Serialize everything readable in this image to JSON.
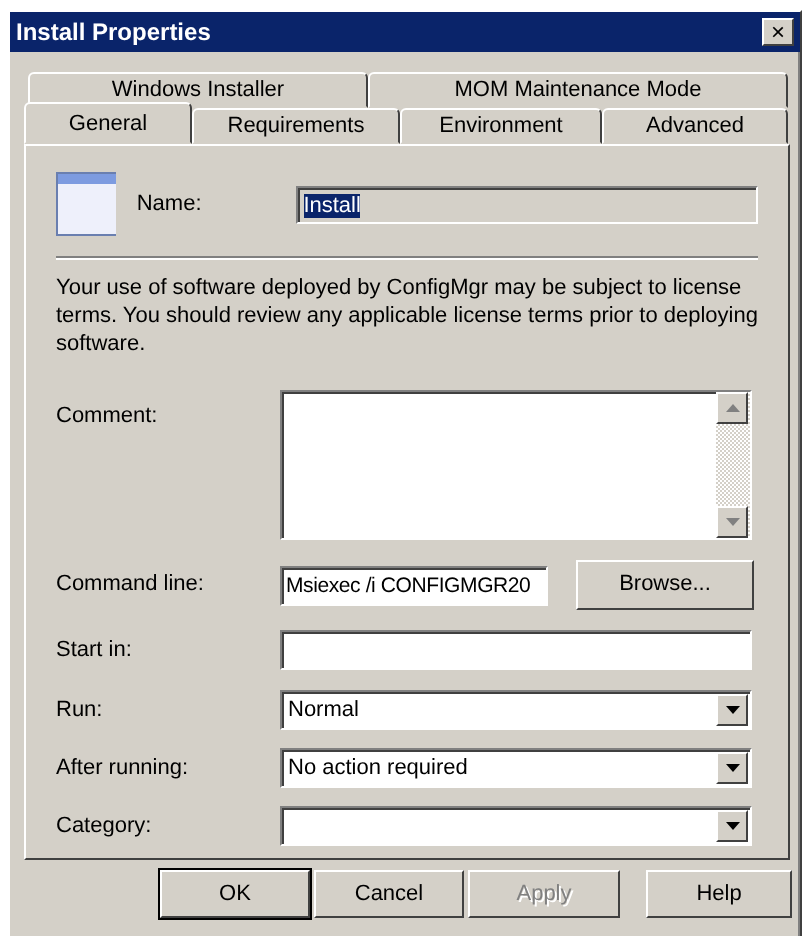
{
  "window": {
    "title": "Install Properties",
    "close": "×"
  },
  "tab_rows": [
    {
      "tabs": [
        {
          "label": "Windows Installer",
          "selected": false
        },
        {
          "label": "MOM Maintenance Mode",
          "selected": false
        }
      ]
    },
    {
      "tabs": [
        {
          "label": "General",
          "selected": true
        },
        {
          "label": "Requirements",
          "selected": false
        },
        {
          "label": "Environment",
          "selected": false
        },
        {
          "label": "Advanced",
          "selected": false
        }
      ]
    }
  ],
  "name": {
    "label": "Name:",
    "value": "Install",
    "value_selected": true
  },
  "notice": "Your use of software deployed by ConfigMgr may be subject to license terms. You should review any applicable license terms prior to deploying software.",
  "fields": [
    {
      "kind": "textarea",
      "label": "Comment:"
    },
    {
      "kind": "text_button",
      "label": "Command line:",
      "value": "Msiexec /i CONFIGMGR20",
      "button": "Browse..."
    },
    {
      "kind": "text",
      "label": "Start in:"
    },
    {
      "kind": "dropdown",
      "label": "Run:",
      "value": "Normal"
    },
    {
      "kind": "dropdown",
      "label": "After running:",
      "value": "No action required"
    },
    {
      "kind": "dropdown",
      "label": "Category:"
    }
  ],
  "buttons": [
    {
      "label": "OK",
      "default": true,
      "disabled": false
    },
    {
      "label": "Cancel",
      "default": false,
      "disabled": false
    },
    {
      "label": "Apply",
      "default": false,
      "disabled": true
    },
    {
      "label": "Help",
      "default": false,
      "disabled": false
    }
  ]
}
